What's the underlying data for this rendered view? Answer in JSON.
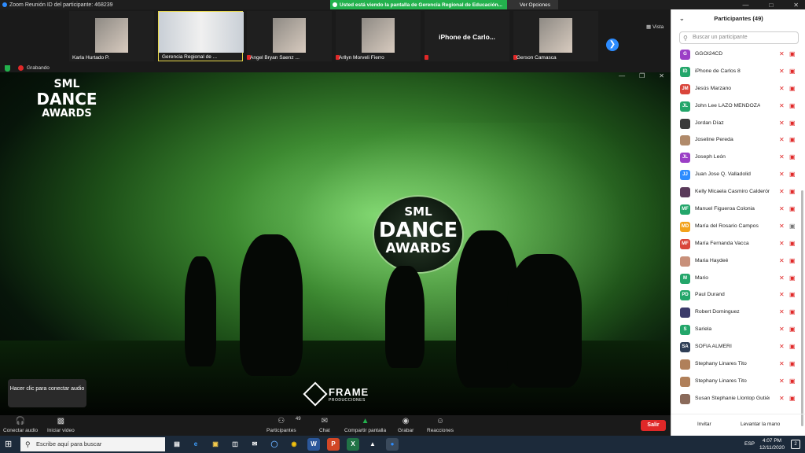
{
  "window": {
    "title": "Zoom Reunión ID del participante: 468239",
    "share_banner": "Usted está viendo la pantalla de Gerencia Regional de Educación...",
    "view_options": "Ver Opciones",
    "view_label": "Vista"
  },
  "gallery": [
    {
      "name": "Karla Hurtado P.",
      "muted": false
    },
    {
      "name": "Gerencia Regional de ...",
      "muted": false,
      "active": true
    },
    {
      "name": "Angel Bryan Saenz ...",
      "muted": true
    },
    {
      "name": "Arllyn Morveli Fierro",
      "muted": true
    },
    {
      "name": "",
      "muted": true,
      "big_name": "iPhone de Carlo..."
    },
    {
      "name": "Gerson Camasca",
      "muted": true
    }
  ],
  "recording": {
    "label": "Grabando"
  },
  "shared_screen": {
    "logo_lines": [
      "SML",
      "DANCE",
      "AWARDS"
    ],
    "backdrop_lines": [
      "SML",
      "DANCE",
      "AWARDS"
    ],
    "watermark_title": "FRAME",
    "watermark_sub": "PRODUCCIONES"
  },
  "tooltip": "Hacer clic para conectar audio",
  "toolbar": {
    "audio": "Conectar audio",
    "video": "Iniciar video",
    "participants": "Participantes",
    "participants_count": "49",
    "chat": "Chat",
    "share": "Compartir pantalla",
    "record": "Grabar",
    "reactions": "Reacciones",
    "leave": "Salir"
  },
  "panel": {
    "title": "Participantes (49)",
    "search_placeholder": "Buscar un participante",
    "invite": "Invitar",
    "raise_hand": "Levantar la mano",
    "participants": [
      {
        "initials": "G",
        "name": "GGOI24CD",
        "color": "#9b3fc6",
        "cam": "off"
      },
      {
        "initials": "ID",
        "name": "iPhone de Carlos 8",
        "color": "#23a66a",
        "cam": "off"
      },
      {
        "initials": "JM",
        "name": "Jesús Marzano",
        "color": "#d9453b",
        "cam": "off"
      },
      {
        "initials": "JL",
        "name": "John Lee LAZO MENDOZA",
        "color": "#23a66a",
        "cam": "off"
      },
      {
        "initials": "",
        "name": "Jordan Díaz",
        "color": "#3b3b3b",
        "cam": "off"
      },
      {
        "initials": "",
        "name": "Joseline Pereda",
        "color": "#b08a6a",
        "cam": "off"
      },
      {
        "initials": "JL",
        "name": "Joseph León",
        "color": "#9b3fc6",
        "cam": "off"
      },
      {
        "initials": "JJ",
        "name": "Juan Jose Q. Valladolid",
        "color": "#2d8cff",
        "cam": "off"
      },
      {
        "initials": "",
        "name": "Kelly Micaela Casmiro Calderón",
        "color": "#5a3a5a",
        "cam": "off"
      },
      {
        "initials": "MF",
        "name": "Manuel Figueroa Colonia",
        "color": "#23a66a",
        "cam": "off"
      },
      {
        "initials": "MD",
        "name": "María del Rosario Campos",
        "color": "#f2a21b",
        "cam": "on"
      },
      {
        "initials": "MF",
        "name": "María Fernanda Vacca",
        "color": "#d9453b",
        "cam": "off"
      },
      {
        "initials": "",
        "name": "Maria Haydeé",
        "color": "#c8907a",
        "cam": "off"
      },
      {
        "initials": "M",
        "name": "Mario",
        "color": "#23a66a",
        "cam": "off"
      },
      {
        "initials": "PD",
        "name": "Paul Durand",
        "color": "#23a66a",
        "cam": "off"
      },
      {
        "initials": "",
        "name": "Robert Dominguez",
        "color": "#3a3a6a",
        "cam": "off"
      },
      {
        "initials": "S",
        "name": "Sariela",
        "color": "#23a66a",
        "cam": "off"
      },
      {
        "initials": "SA",
        "name": "SOFIA ALMERI",
        "color": "#2f3f57",
        "cam": "off"
      },
      {
        "initials": "",
        "name": "Stephany Linares Tito",
        "color": "#b0805a",
        "cam": "off"
      },
      {
        "initials": "",
        "name": "Stephany Linares Tito",
        "color": "#b0805a",
        "cam": "off"
      },
      {
        "initials": "",
        "name": "Susan Stephanie Llontop Gutiérrez",
        "color": "#8a6a5a",
        "cam": "off"
      }
    ]
  },
  "taskbar": {
    "search_placeholder": "Escribe aquí para buscar",
    "lang": "ESP",
    "time": "4:07 PM",
    "date": "12/11/2020",
    "notifications": "2"
  }
}
